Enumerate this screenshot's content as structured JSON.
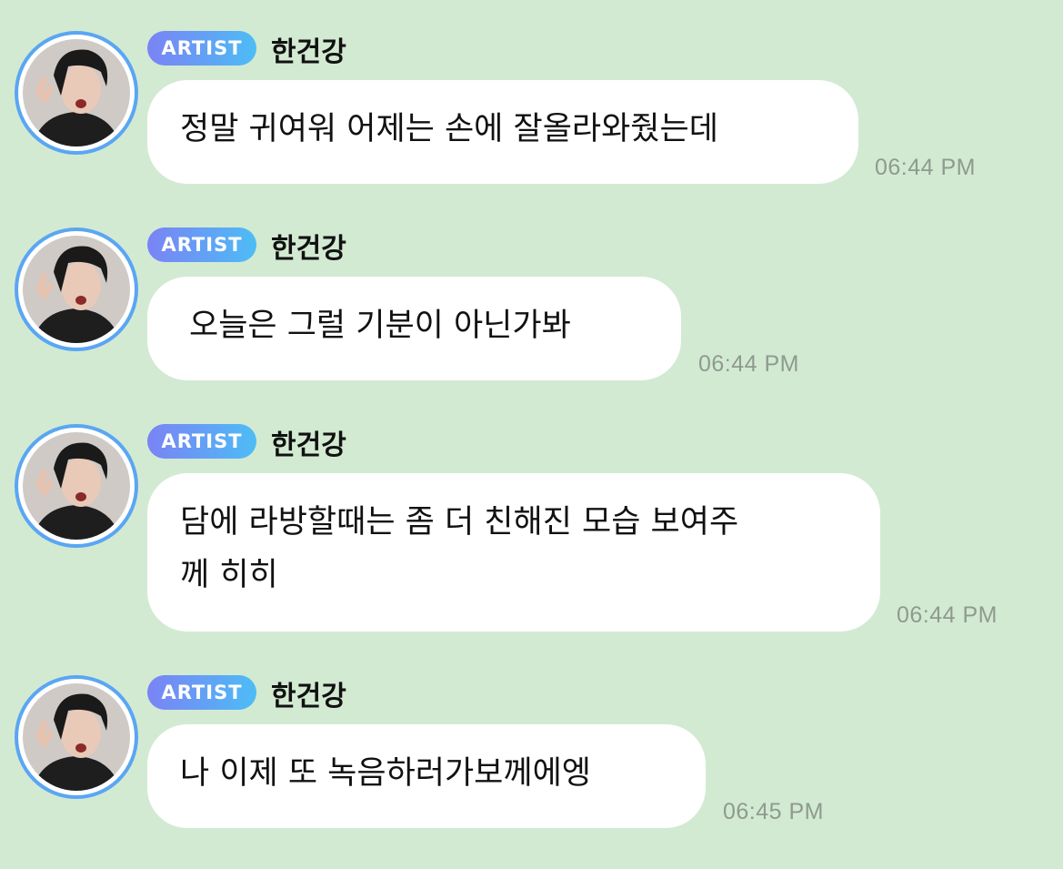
{
  "colors": {
    "background": "#d3ead2",
    "bubble": "#ffffff",
    "badge_gradient_start": "#7b83f5",
    "badge_gradient_end": "#4dbdf5",
    "avatar_ring": "#5aa6f3",
    "time_text": "#8f9a8f"
  },
  "messages": [
    {
      "badge": "ARTIST",
      "sender": "한건강",
      "text": "정말 귀여워 어제는 손에 잘올라와줬는데",
      "time": "06:44 PM"
    },
    {
      "badge": "ARTIST",
      "sender": "한건강",
      "text": "오늘은 그럴 기분이 아닌가봐",
      "time": "06:44 PM"
    },
    {
      "badge": "ARTIST",
      "sender": "한건강",
      "text_line1": "담에 라방할때는 좀 더 친해진 모습 보여주",
      "text_line2": "께 히히",
      "time": "06:44 PM"
    },
    {
      "badge": "ARTIST",
      "sender": "한건강",
      "text": "나 이제 또 녹음하러가보께에엥",
      "time": "06:45 PM"
    }
  ]
}
